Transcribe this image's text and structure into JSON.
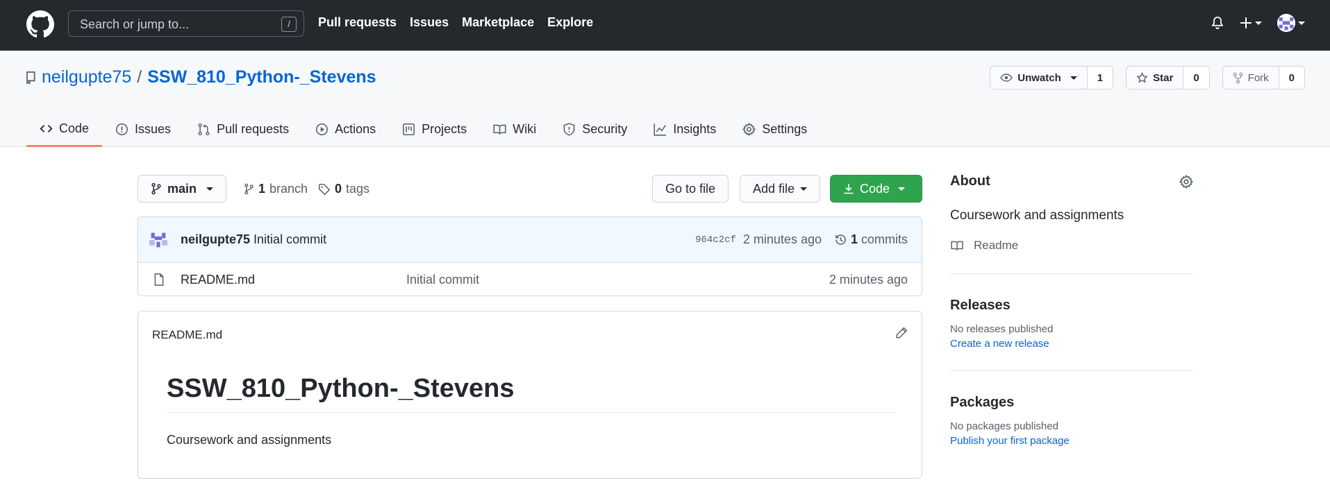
{
  "header": {
    "search_placeholder": "Search or jump to...",
    "search_shortcut": "/",
    "nav": [
      "Pull requests",
      "Issues",
      "Marketplace",
      "Explore"
    ],
    "icons": [
      "github-logo-icon",
      "bell-icon",
      "plus-icon",
      "avatar"
    ]
  },
  "repo": {
    "owner": "neilgupte75",
    "separator": "/",
    "name": "SSW_810_Python-_Stevens",
    "watch_label": "Unwatch",
    "watch_count": "1",
    "star_label": "Star",
    "star_count": "0",
    "fork_label": "Fork",
    "fork_count": "0"
  },
  "tabs": [
    "Code",
    "Issues",
    "Pull requests",
    "Actions",
    "Projects",
    "Wiki",
    "Security",
    "Insights",
    "Settings"
  ],
  "branch": {
    "current": "main",
    "branch_count": "1",
    "branch_word": "branch",
    "tag_count": "0",
    "tag_word": "tags",
    "go_to_file": "Go to file",
    "add_file": "Add file",
    "code": "Code"
  },
  "latest_commit": {
    "author": "neilgupte75",
    "message": "Initial commit",
    "sha": "964c2cf",
    "age": "2 minutes ago",
    "commit_count": "1",
    "commit_word": "commits"
  },
  "files": [
    {
      "name": "README.md",
      "message": "Initial commit",
      "age": "2 minutes ago"
    }
  ],
  "readme": {
    "filename": "README.md",
    "heading": "SSW_810_Python-_Stevens",
    "body": "Coursework and assignments"
  },
  "sidebar": {
    "about_title": "About",
    "description": "Coursework and assignments",
    "readme_link": "Readme",
    "releases_title": "Releases",
    "releases_none": "No releases published",
    "releases_link": "Create a new release",
    "packages_title": "Packages",
    "packages_none": "No packages published",
    "packages_link": "Publish your first package"
  },
  "colors": {
    "header_bg": "#24292e",
    "link": "#0366d6",
    "green_button": "#2ea44f",
    "active_tab_underline": "#f9826c",
    "commit_bar_bg": "#f1f8ff"
  }
}
